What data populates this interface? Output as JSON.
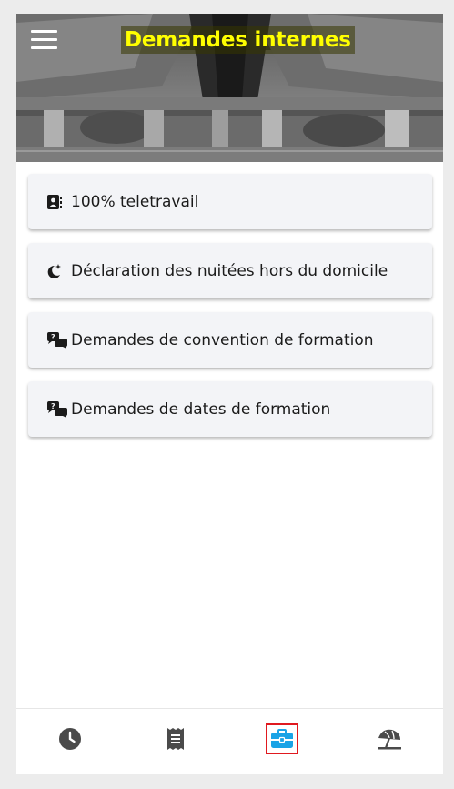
{
  "header": {
    "title": "Demandes internes"
  },
  "menu": {
    "items": [
      {
        "label": "100% teletravail",
        "icon": "contact-book-icon"
      },
      {
        "label": "Déclaration des nuitées hors du domicile",
        "icon": "moon-star-icon"
      },
      {
        "label": "Demandes de convention de formation",
        "icon": "question-chat-icon"
      },
      {
        "label": "Demandes de dates de formation",
        "icon": "question-chat-icon"
      }
    ]
  },
  "bottom_nav": {
    "items": [
      {
        "icon": "clock-icon",
        "active": false
      },
      {
        "icon": "receipt-icon",
        "active": false
      },
      {
        "icon": "briefcase-icon",
        "active": true
      },
      {
        "icon": "beach-umbrella-icon",
        "active": false
      }
    ]
  },
  "colors": {
    "title": "#ffff00",
    "accent": "#1aa3e6",
    "nav_icon": "#4a4a4a",
    "active_outline": "#e0191f"
  }
}
